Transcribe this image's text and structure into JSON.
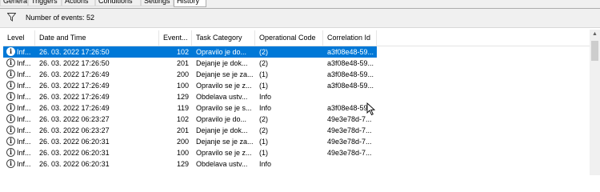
{
  "tabs": [
    {
      "label": "General",
      "active": false
    },
    {
      "label": "Triggers",
      "active": false
    },
    {
      "label": "Actions",
      "active": false
    },
    {
      "label": "Conditions",
      "active": false
    },
    {
      "label": "Settings",
      "active": false
    },
    {
      "label": "History",
      "active": true
    }
  ],
  "filter": {
    "icon": "filter-funnel-icon",
    "text": "Number of events: 52"
  },
  "columns": [
    "Level",
    "Date and Time",
    "Event...",
    "Task Category",
    "Operational Code",
    "Correlation Id"
  ],
  "colors": {
    "selected_row": "#0078d7",
    "header_bg": "#f0f0f0"
  },
  "rows": [
    {
      "level": "Inf...",
      "datetime": "26. 03. 2022 17:26:50",
      "event": "102",
      "task": "Opravilo je do...",
      "opcode": "(2)",
      "correlation": "a3f08e48-59...",
      "selected": true
    },
    {
      "level": "Inf...",
      "datetime": "26. 03. 2022 17:26:50",
      "event": "201",
      "task": "Dejanje je dok...",
      "opcode": "(2)",
      "correlation": "a3f08e48-59..."
    },
    {
      "level": "Inf...",
      "datetime": "26. 03. 2022 17:26:49",
      "event": "200",
      "task": "Dejanje se je za...",
      "opcode": "(1)",
      "correlation": "a3f08e48-59..."
    },
    {
      "level": "Inf...",
      "datetime": "26. 03. 2022 17:26:49",
      "event": "100",
      "task": "Opravilo se je z...",
      "opcode": "(1)",
      "correlation": "a3f08e48-59..."
    },
    {
      "level": "Inf...",
      "datetime": "26. 03. 2022 17:26:49",
      "event": "129",
      "task": "Obdelava ustv...",
      "opcode": "Info",
      "correlation": ""
    },
    {
      "level": "Inf...",
      "datetime": "26. 03. 2022 17:26:49",
      "event": "119",
      "task": "Opravilo se je s...",
      "opcode": "Info",
      "correlation": "a3f08e48-59..."
    },
    {
      "level": "Inf...",
      "datetime": "26. 03. 2022 06:23:27",
      "event": "102",
      "task": "Opravilo je do...",
      "opcode": "(2)",
      "correlation": "49e3e78d-7..."
    },
    {
      "level": "Inf...",
      "datetime": "26. 03. 2022 06:23:27",
      "event": "201",
      "task": "Dejanje je dok...",
      "opcode": "(2)",
      "correlation": "49e3e78d-7..."
    },
    {
      "level": "Inf...",
      "datetime": "26. 03. 2022 06:20:31",
      "event": "200",
      "task": "Dejanje se je za...",
      "opcode": "(1)",
      "correlation": "49e3e78d-7..."
    },
    {
      "level": "Inf...",
      "datetime": "26. 03. 2022 06:20:31",
      "event": "100",
      "task": "Opravilo se je z...",
      "opcode": "(1)",
      "correlation": "49e3e78d-7..."
    },
    {
      "level": "Inf...",
      "datetime": "26. 03. 2022 06:20:31",
      "event": "129",
      "task": "Obdelava ustv...",
      "opcode": "Info",
      "correlation": ""
    }
  ],
  "scrollbar": {
    "up_arrow": "chevron-up-icon"
  }
}
